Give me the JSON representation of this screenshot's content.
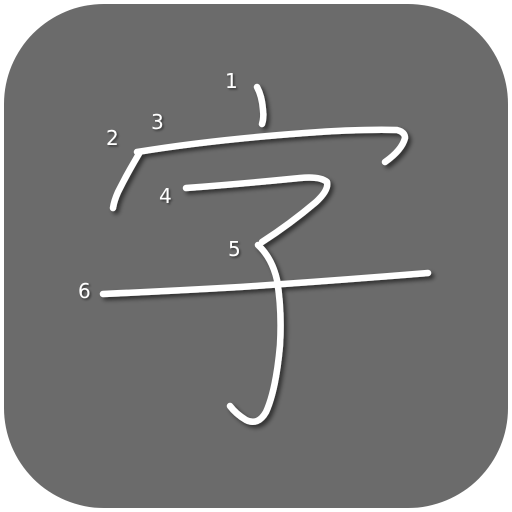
{
  "app_icon": {
    "background_color": "#6b6b6b",
    "stroke_color": "#ffffff",
    "stroke_numbers": [
      "1",
      "2",
      "3",
      "4",
      "5",
      "6"
    ]
  }
}
